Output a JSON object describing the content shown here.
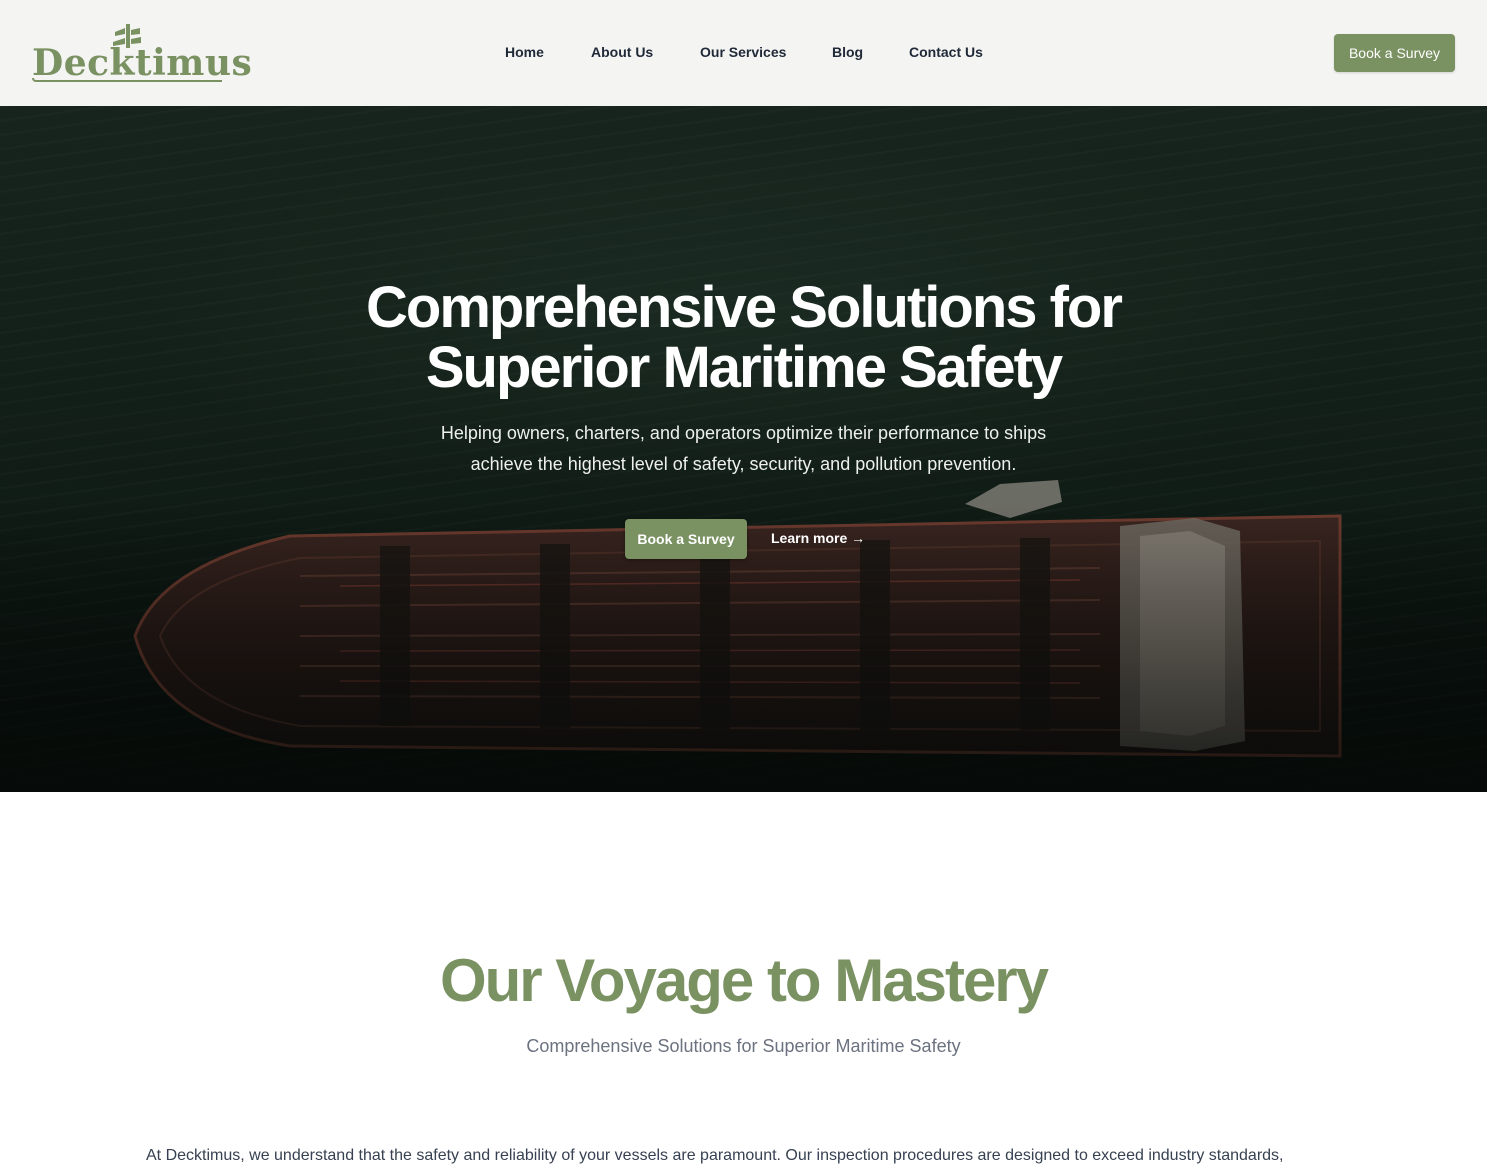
{
  "brand": {
    "logo_text": "Decktimus",
    "brand_color": "#7a9162"
  },
  "nav": {
    "items": [
      {
        "label": "Home"
      },
      {
        "label": "About Us"
      },
      {
        "label": "Our Services"
      },
      {
        "label": "Blog"
      },
      {
        "label": "Contact Us"
      }
    ],
    "cta_label": "Book a Survey"
  },
  "hero": {
    "title_line1": "Comprehensive Solutions for",
    "title_line2": "Superior Maritime Safety",
    "subtitle_line1": "Helping owners, charters, and operators optimize their performance to ships",
    "subtitle_line2": "achieve the highest level of safety, security, and pollution prevention.",
    "cta_label": "Book a Survey",
    "secondary_label": "Learn more →"
  },
  "section": {
    "title": "Our Voyage to Mastery",
    "subtitle": "Comprehensive Solutions for Superior Maritime Safety",
    "body": "At Decktimus, we understand that the safety and reliability of your vessels are paramount. Our inspection procedures are designed to exceed industry standards,"
  }
}
